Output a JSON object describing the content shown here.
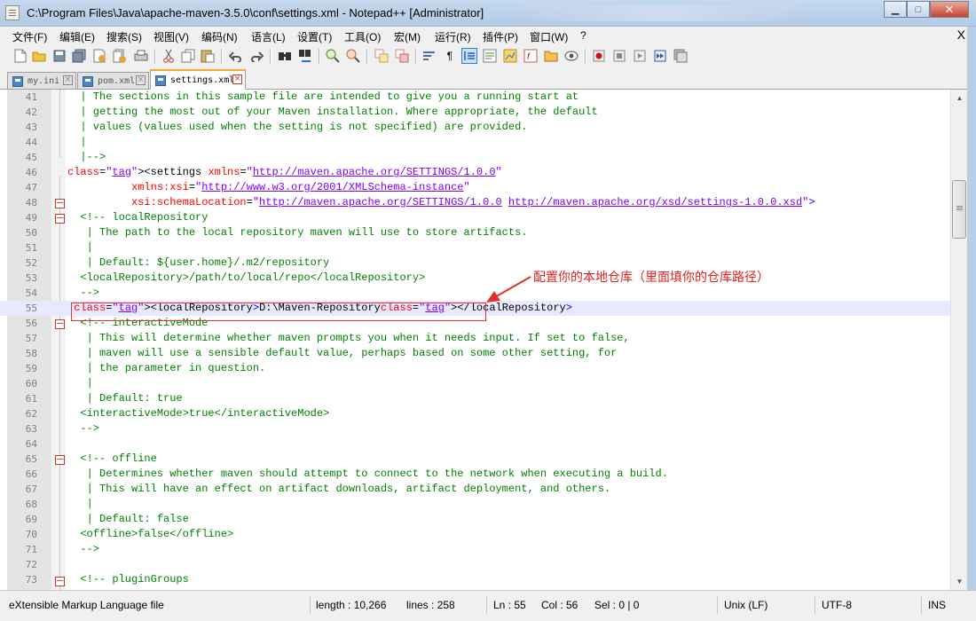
{
  "window": {
    "title": "C:\\Program Files\\Java\\apache-maven-3.5.0\\conf\\settings.xml - Notepad++ [Administrator]",
    "minimize_glyph": "▁",
    "maximize_glyph": "□",
    "close_glyph": "✕"
  },
  "menu": {
    "items": [
      "文件(F)",
      "编辑(E)",
      "搜索(S)",
      "视图(V)",
      "编码(N)",
      "语言(L)",
      "设置(T)",
      "工具(O)",
      "宏(M)",
      "运行(R)",
      "插件(P)",
      "窗口(W)",
      "?"
    ],
    "close_glyph": "X"
  },
  "toolbar": {
    "icons": [
      "new-file-icon",
      "open-file-icon",
      "save-icon",
      "save-all-icon",
      "close-icon",
      "close-all-icon",
      "print-icon",
      "cut-icon",
      "copy-icon",
      "paste-icon",
      "undo-icon",
      "redo-icon",
      "find-icon",
      "replace-icon",
      "zoom-in-icon",
      "zoom-out-icon",
      "sync-vertical-icon",
      "sync-horizontal-icon",
      "word-wrap-icon",
      "show-all-characters-icon",
      "indent-guide-icon",
      "user-language-icon",
      "document-map-icon",
      "function-list-icon",
      "folder-as-workspace-icon",
      "monitoring-icon",
      "record-macro-icon",
      "stop-record-icon",
      "play-macro-icon",
      "run-macro-multiple-icon",
      "save-macro-icon"
    ]
  },
  "tabs": [
    {
      "label": "my.ini",
      "active": false
    },
    {
      "label": "pom.xml",
      "active": false
    },
    {
      "label": "settings.xml",
      "active": true
    }
  ],
  "editor": {
    "current_line": 55,
    "lines": [
      {
        "n": "41",
        "text": "  | The sections in this sample file are intended to give you a running start at"
      },
      {
        "n": "42",
        "text": "  | getting the most out of your Maven installation. Where appropriate, the default"
      },
      {
        "n": "43",
        "text": "  | values (values used when the setting is not specified) are provided."
      },
      {
        "n": "44",
        "text": "  |"
      },
      {
        "n": "45",
        "text": "  |-->"
      },
      {
        "n": "46",
        "text": "<settings xmlns=\"http://maven.apache.org/SETTINGS/1.0.0\""
      },
      {
        "n": "47",
        "text": "          xmlns:xsi=\"http://www.w3.org/2001/XMLSchema-instance\""
      },
      {
        "n": "48",
        "text": "          xsi:schemaLocation=\"http://maven.apache.org/SETTINGS/1.0.0 http://maven.apache.org/xsd/settings-1.0.0.xsd\">"
      },
      {
        "n": "49",
        "text": "  <!-- localRepository"
      },
      {
        "n": "50",
        "text": "   | The path to the local repository maven will use to store artifacts."
      },
      {
        "n": "51",
        "text": "   |"
      },
      {
        "n": "52",
        "text": "   | Default: ${user.home}/.m2/repository"
      },
      {
        "n": "53",
        "text": "  <localRepository>/path/to/local/repo</localRepository>"
      },
      {
        "n": "54",
        "text": "  -->"
      },
      {
        "n": "55",
        "text": " <localRepository>D:\\Maven-Repository</localRepository>"
      },
      {
        "n": "56",
        "text": "  <!-- interactiveMode"
      },
      {
        "n": "57",
        "text": "   | This will determine whether maven prompts you when it needs input. If set to false,"
      },
      {
        "n": "58",
        "text": "   | maven will use a sensible default value, perhaps based on some other setting, for"
      },
      {
        "n": "59",
        "text": "   | the parameter in question."
      },
      {
        "n": "60",
        "text": "   |"
      },
      {
        "n": "61",
        "text": "   | Default: true"
      },
      {
        "n": "62",
        "text": "  <interactiveMode>true</interactiveMode>"
      },
      {
        "n": "63",
        "text": "  -->"
      },
      {
        "n": "64",
        "text": ""
      },
      {
        "n": "65",
        "text": "  <!-- offline"
      },
      {
        "n": "66",
        "text": "   | Determines whether maven should attempt to connect to the network when executing a build."
      },
      {
        "n": "67",
        "text": "   | This will have an effect on artifact downloads, artifact deployment, and others."
      },
      {
        "n": "68",
        "text": "   |"
      },
      {
        "n": "69",
        "text": "   | Default: false"
      },
      {
        "n": "70",
        "text": "  <offline>false</offline>"
      },
      {
        "n": "71",
        "text": "  -->"
      },
      {
        "n": "72",
        "text": ""
      },
      {
        "n": "73",
        "text": "  <!-- pluginGroups"
      }
    ]
  },
  "annotation": {
    "text": "配置你的本地仓库（里面填你的仓库路径）",
    "color": "#e02020"
  },
  "status": {
    "language": "eXtensible Markup Language file",
    "length": "length : 10,266",
    "lines": "lines : 258",
    "ln": "Ln : 55",
    "col": "Col : 56",
    "sel": "Sel : 0 | 0",
    "eol": "Unix (LF)",
    "encoding": "UTF-8",
    "mode": "INS"
  },
  "colors": {
    "comment": "#008000",
    "tag": "#0000ff",
    "attribute": "#ff0000",
    "string": "#8000ff",
    "current_line": "#e8e8ff"
  }
}
